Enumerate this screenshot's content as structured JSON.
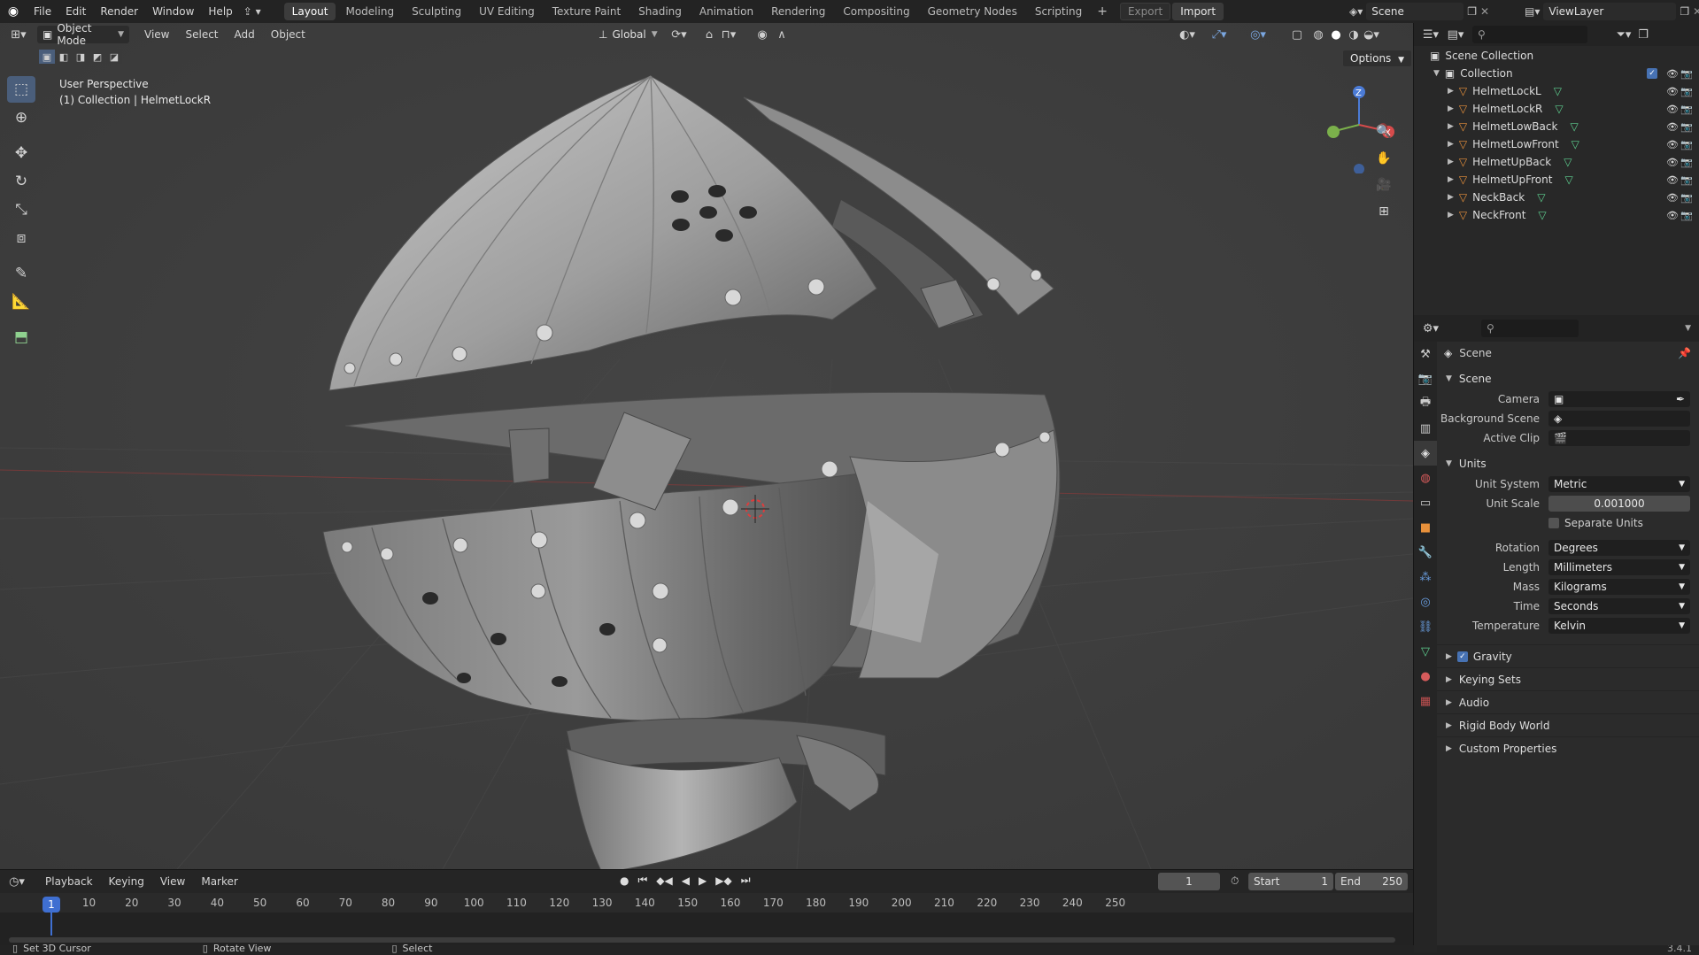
{
  "topbar": {
    "menus": [
      "File",
      "Edit",
      "Render",
      "Window",
      "Help"
    ],
    "workspaces": [
      "Layout",
      "Modeling",
      "Sculpting",
      "UV Editing",
      "Texture Paint",
      "Shading",
      "Animation",
      "Rendering",
      "Compositing",
      "Geometry Nodes",
      "Scripting"
    ],
    "active_workspace": "Layout",
    "export_label": "Export",
    "import_label": "Import",
    "scene_name": "Scene",
    "view_layer": "ViewLayer"
  },
  "viewport": {
    "mode": "Object Mode",
    "menus": [
      "View",
      "Select",
      "Add",
      "Object"
    ],
    "orientation": "Global",
    "options_label": "Options",
    "perspective_label": "User Perspective",
    "collection_label": "(1) Collection | HelmetLockR"
  },
  "outliner": {
    "root": "Scene Collection",
    "collection": "Collection",
    "objects": [
      "HelmetLockL",
      "HelmetLockR",
      "HelmetLowBack",
      "HelmetLowFront",
      "HelmetUpBack",
      "HelmetUpFront",
      "NeckBack",
      "NeckFront"
    ]
  },
  "properties": {
    "context": "Scene",
    "scene_panel": "Scene",
    "camera_label": "Camera",
    "background_scene_label": "Background Scene",
    "active_clip_label": "Active Clip",
    "units_panel": "Units",
    "unit_system_label": "Unit System",
    "unit_system": "Metric",
    "unit_scale_label": "Unit Scale",
    "unit_scale": "0.001000",
    "separate_units_label": "Separate Units",
    "rotation_label": "Rotation",
    "rotation": "Degrees",
    "length_label": "Length",
    "length": "Millimeters",
    "mass_label": "Mass",
    "mass": "Kilograms",
    "time_label": "Time",
    "time": "Seconds",
    "temperature_label": "Temperature",
    "temperature": "Kelvin",
    "collapsed_panels": [
      "Gravity",
      "Keying Sets",
      "Audio",
      "Rigid Body World",
      "Custom Properties"
    ]
  },
  "timeline": {
    "menus": [
      "Playback",
      "Keying",
      "View",
      "Marker"
    ],
    "current_frame": "1",
    "start_label": "Start",
    "start": "1",
    "end_label": "End",
    "end": "250",
    "ticks": [
      "10",
      "20",
      "30",
      "40",
      "50",
      "60",
      "70",
      "80",
      "90",
      "100",
      "110",
      "120",
      "130",
      "140",
      "150",
      "160",
      "170",
      "180",
      "190",
      "200",
      "210",
      "220",
      "230",
      "240",
      "250"
    ]
  },
  "statusbar": {
    "hint1": "Set 3D Cursor",
    "hint2": "Rotate View",
    "hint3": "Select",
    "version": "3.4.1"
  }
}
